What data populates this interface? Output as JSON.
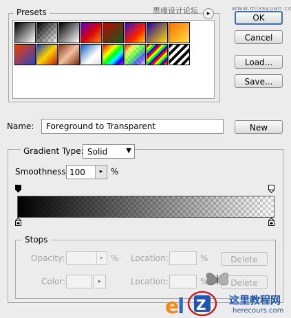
{
  "presets": {
    "legend": "Presets",
    "watermark": "思缘设计论坛",
    "watermark_url": "www.missyuan.com"
  },
  "buttons": {
    "ok": "OK",
    "cancel": "Cancel",
    "load": "Load...",
    "save": "Save...",
    "new": "New"
  },
  "name": {
    "label": "Name:",
    "value": "Foreground to Transparent"
  },
  "gradient": {
    "type_label": "Gradient Type:",
    "type_value": "Solid",
    "smoothness_label": "Smoothness:",
    "smoothness_value": "100",
    "smoothness_unit": "%"
  },
  "stops": {
    "legend": "Stops",
    "opacity_label": "Opacity:",
    "opacity_unit": "%",
    "color_label": "Color:",
    "location_label": "Location:",
    "location_unit": "%",
    "delete": "Delete"
  },
  "footer": {
    "site_name": "这里教程网",
    "site_url": "herecours.com"
  },
  "colors": {
    "dialog_bg": "#ececec",
    "default_button_border": "#3a6fb6",
    "disabled_text": "#a5a5a5"
  }
}
